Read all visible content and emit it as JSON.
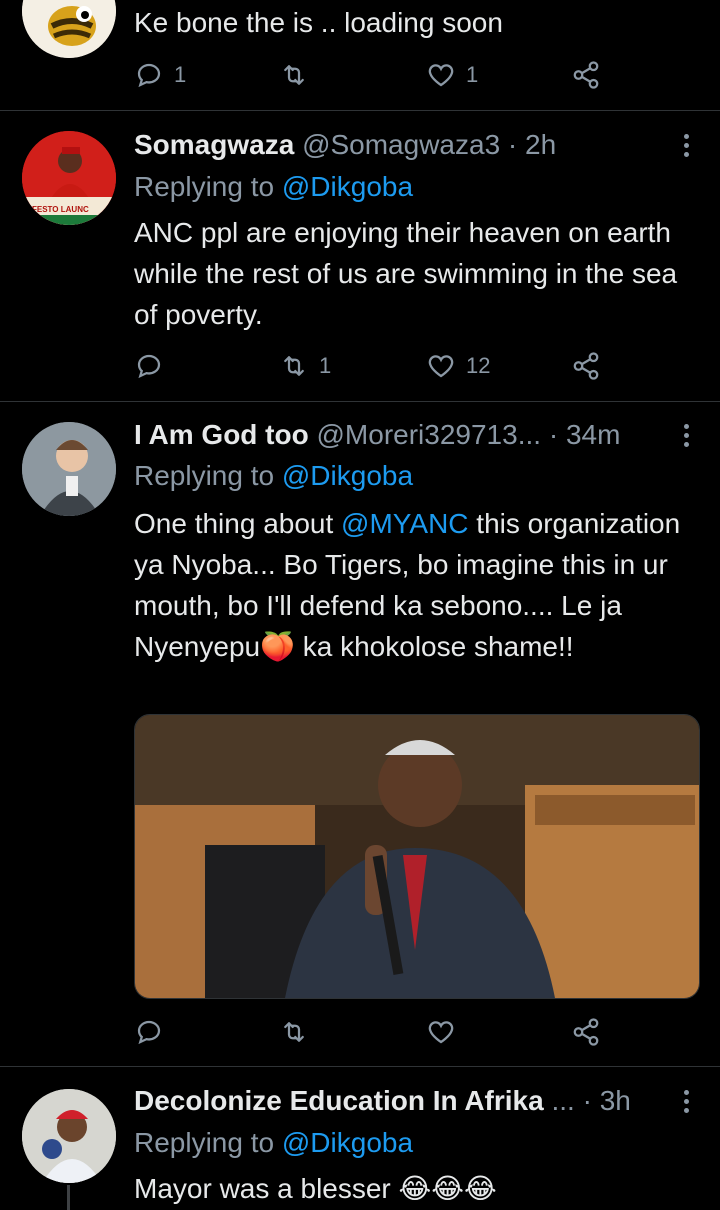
{
  "tweets": [
    {
      "text": "Ke bone the is .. loading soon",
      "replies": "1",
      "retweets": "",
      "likes": "1"
    },
    {
      "name": "Somagwaza",
      "handle": "@Somagwaza3",
      "dot": "·",
      "time": "2h",
      "replying_prefix": "Replying to",
      "replying_to": "@Dikgoba",
      "text": "ANC ppl are enjoying their heaven on earth while the rest of us are swimming in the sea of poverty.",
      "replies": "",
      "retweets": "1",
      "likes": "12",
      "avatar_banner": "NIFESTO LAUNC"
    },
    {
      "name": "I Am God too",
      "handle": "@Moreri329713...",
      "dot": "·",
      "time": "34m",
      "replying_prefix": "Replying to",
      "replying_to": "@Dikgoba",
      "text_before": "One thing about ",
      "text_mention": "@MYANC",
      "text_after": " this organization ya Nyoba... Bo Tigers, bo imagine this in ur mouth, bo I'll defend ka sebono.... Le ja Nyenyepu",
      "text_emoji": "🍑",
      "text_end": " ka khokolose shame!!",
      "replies": "",
      "retweets": "",
      "likes": ""
    },
    {
      "name": "Decolonize Education In Afrika",
      "ellipsis": "...",
      "dot": "·",
      "time": "3h",
      "replying_prefix": "Replying to",
      "replying_to": "@Dikgoba",
      "text": "Mayor was a blesser",
      "text_emoji": "😂😂😂"
    }
  ],
  "colors": {
    "background": "#000000",
    "text_primary": "#e7e9ea",
    "text_secondary": "#8b98a5",
    "link": "#1d9bf0",
    "divider": "#2f3336"
  }
}
